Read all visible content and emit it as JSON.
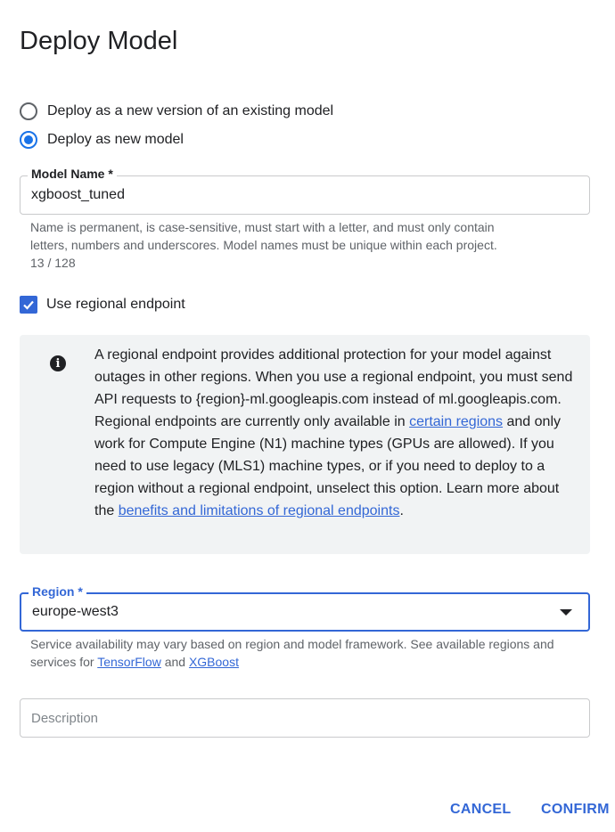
{
  "dialog": {
    "title": "Deploy Model"
  },
  "deploy_options": [
    {
      "label": "Deploy as a new version of an existing model",
      "selected": false
    },
    {
      "label": "Deploy as new model",
      "selected": true
    }
  ],
  "model_name": {
    "label": "Model Name *",
    "value": "xgboost_tuned",
    "hint_line1": "Name is permanent, is case-sensitive, must start with a letter, and must only contain",
    "hint_line2": "letters, numbers and underscores. Model names must be unique within each project.",
    "counter": "13 / 128"
  },
  "regional_endpoint": {
    "label": "Use regional endpoint",
    "checked": true
  },
  "info": {
    "icon": "info-icon",
    "text_part1": "A regional endpoint provides additional protection for your model against outages in other regions. When you use a regional endpoint, you must send API requests to {region}-ml.googleapis.com instead of ml.googleapis.com. Regional endpoints are currently only available in ",
    "link1": "certain regions",
    "text_part2": " and only work for Compute Engine (N1) machine types (GPUs are allowed). If you need to use legacy (MLS1) machine types, or if you need to deploy to a region without a regional endpoint, unselect this option. Learn more about the ",
    "link2": "benefits and limitations of regional endpoints",
    "text_part3": "."
  },
  "region": {
    "label": "Region *",
    "value": "europe-west3",
    "hint_part1": "Service availability may vary based on region and model framework. See available regions and services for ",
    "link_tensorflow": "TensorFlow",
    "hint_and": " and ",
    "link_xgboost": "XGBoost"
  },
  "description": {
    "placeholder": "Description"
  },
  "actions": {
    "cancel": "CANCEL",
    "confirm": "CONFIRM"
  },
  "colors": {
    "accent": "#3367d6",
    "radio_accent": "#1a73e8",
    "info_bg": "#f1f3f4"
  }
}
